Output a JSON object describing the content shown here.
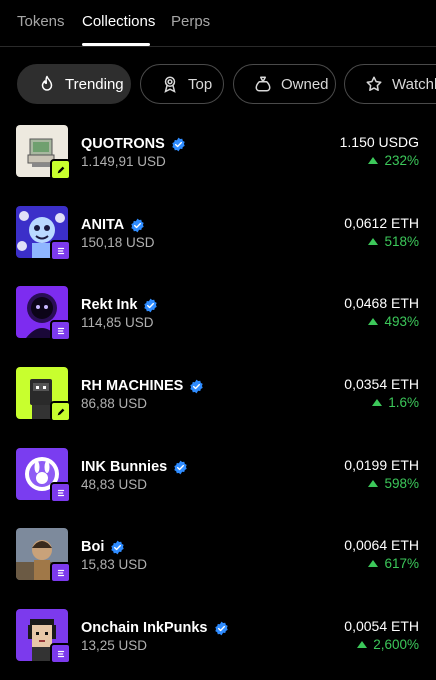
{
  "tabs": [
    {
      "label": "Tokens"
    },
    {
      "label": "Collections"
    },
    {
      "label": "Perps"
    }
  ],
  "active_tab": "Collections",
  "filters": [
    {
      "label": "Trending",
      "icon": "flame-icon",
      "active": true
    },
    {
      "label": "Top",
      "icon": "medal-icon",
      "active": false
    },
    {
      "label": "Owned",
      "icon": "bag-icon",
      "active": false
    },
    {
      "label": "Watchlist",
      "icon": "star-icon",
      "active": false
    }
  ],
  "collections": [
    {
      "name": "QUOTRONS",
      "verified": true,
      "value": "1.149,91 USD",
      "price": "1.150 USDG",
      "change": "232%",
      "badge": "pen-icon",
      "badge_color": "#c8ff2e"
    },
    {
      "name": "ANITA",
      "verified": true,
      "value": "150,18 USD",
      "price": "0,0612 ETH",
      "change": "518%",
      "badge": "ink-icon",
      "badge_color": "#7c3aed"
    },
    {
      "name": "Rekt Ink",
      "verified": true,
      "value": "114,85 USD",
      "price": "0,0468 ETH",
      "change": "493%",
      "badge": "ink-icon",
      "badge_color": "#7c3aed"
    },
    {
      "name": "RH MACHINES",
      "verified": true,
      "value": "86,88 USD",
      "price": "0,0354 ETH",
      "change": "1.6%",
      "badge": "pen-icon",
      "badge_color": "#c8ff2e"
    },
    {
      "name": "INK Bunnies",
      "verified": true,
      "value": "48,83 USD",
      "price": "0,0199 ETH",
      "change": "598%",
      "badge": "ink-icon",
      "badge_color": "#7c3aed"
    },
    {
      "name": "Boi",
      "verified": true,
      "value": "15,83 USD",
      "price": "0,0064 ETH",
      "change": "617%",
      "badge": "ink-icon",
      "badge_color": "#7c3aed"
    },
    {
      "name": "Onchain InkPunks",
      "verified": true,
      "value": "13,25 USD",
      "price": "0,0054 ETH",
      "change": "2,600%",
      "badge": "ink-icon",
      "badge_color": "#7c3aed"
    }
  ],
  "colors": {
    "positive": "#3cc85a",
    "verified": "#2f8cff",
    "background": "#000000"
  }
}
